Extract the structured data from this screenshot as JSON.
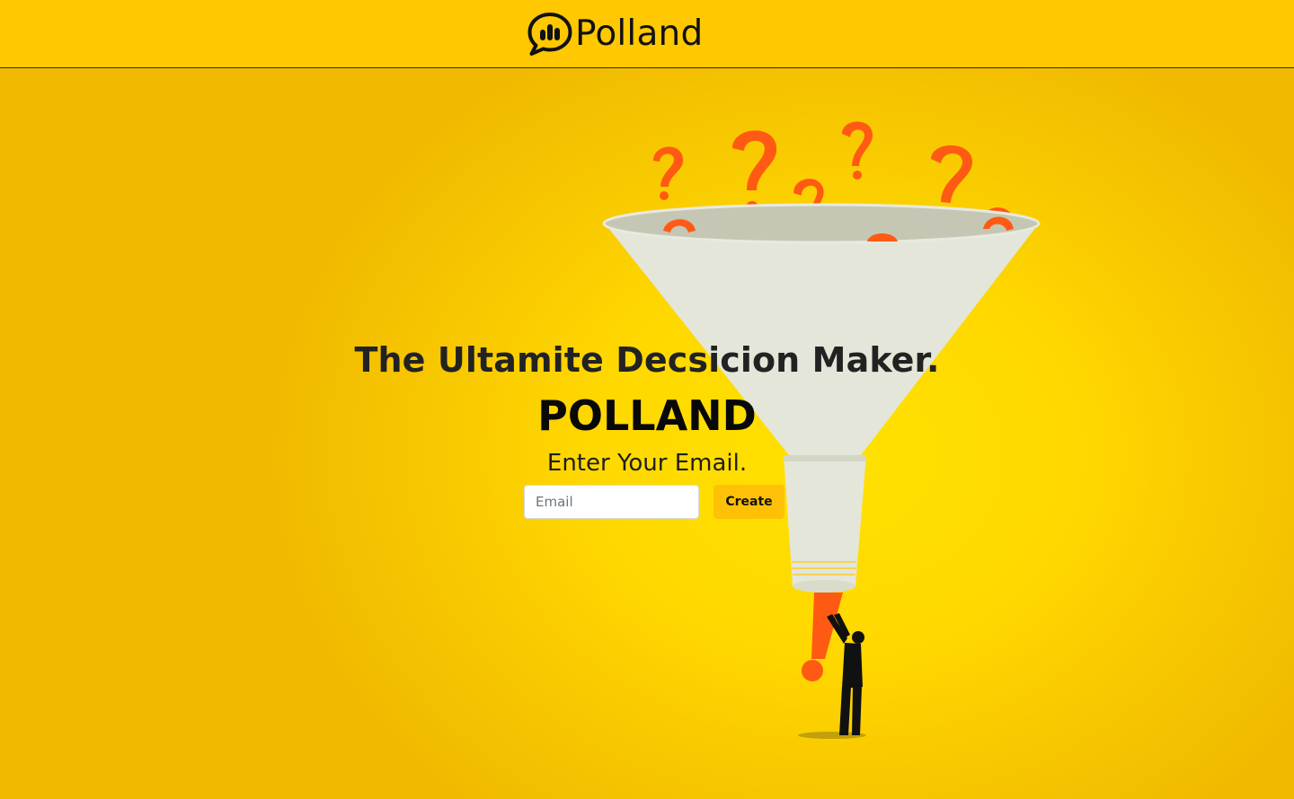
{
  "header": {
    "brand_name": "Polland",
    "logo_icon": "speech-bubble-bar-chart-icon"
  },
  "hero": {
    "headline": "The Ultamite Decsicion Maker.",
    "brand_title": "POLLAND",
    "prompt": "Enter Your Email.",
    "email_placeholder": "Email",
    "email_value": "",
    "create_label": "Create",
    "illustration": "funnel-question-marks-illustration"
  },
  "colors": {
    "header_background": "#ffc800",
    "hero_background": "#ffd800",
    "button_background": "#ffc107",
    "question_mark": "#ff5a14",
    "funnel": "#e3e6d8"
  }
}
